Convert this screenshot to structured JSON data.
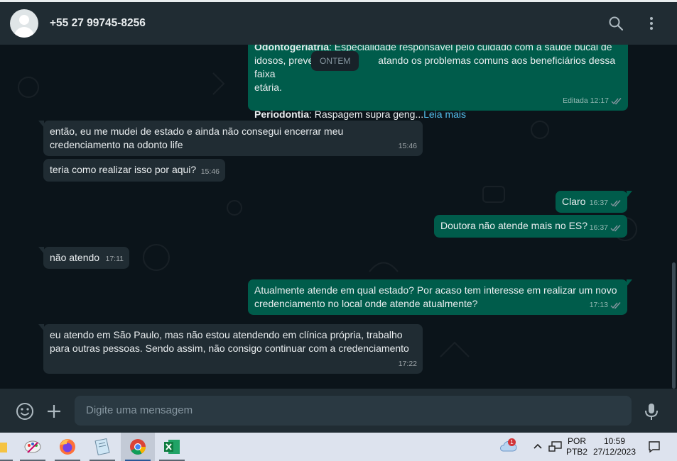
{
  "header": {
    "contact_name": "+55 27 99745-8256",
    "icons": [
      "search-icon",
      "menu-icon"
    ]
  },
  "chat": {
    "date_divider": "ONTEM",
    "messages": [
      {
        "direction": "outgoing",
        "line1_bold": "Odontogeriatria",
        "line1_rest": ": Especialidade responsável pelo cuidado com a saúde bucal de",
        "line2": "idosos, preve",
        "line2_rest": "atando os problemas comuns aos beneficiários dessa faixa",
        "line3": "etária.",
        "line4_bold": "Periodontia",
        "line4_rest": ": Raspagem supra geng...",
        "read_more": "Leia mais",
        "edited": "Editada",
        "time": "12:17",
        "status": "read"
      },
      {
        "direction": "incoming",
        "line1": "então, eu me mudei de estado e ainda não consegui encerrar meu",
        "line2": "credenciamento na odonto life",
        "time": "15:46"
      },
      {
        "direction": "incoming",
        "text": "teria como realizar isso por aqui?",
        "time": "15:46"
      },
      {
        "direction": "outgoing",
        "text": "Claro",
        "time": "16:37",
        "status": "read"
      },
      {
        "direction": "outgoing",
        "text": "Doutora não atende mais no ES?",
        "time": "16:37",
        "status": "read"
      },
      {
        "direction": "incoming",
        "text": "não atendo",
        "time": "17:11"
      },
      {
        "direction": "outgoing",
        "line1": "Atualmente atende em qual estado? Por acaso tem interesse em realizar um novo",
        "line2": "credenciamento no local onde atende atualmente?",
        "time": "17:13",
        "status": "read"
      },
      {
        "direction": "incoming",
        "line1": "eu atendo em São Paulo, mas não estou atendendo em clínica própria, trabalho",
        "line2": "para outras pessoas. Sendo assim, não consigo continuar com a credenciamento",
        "time": "17:22"
      }
    ]
  },
  "composer": {
    "placeholder": "Digite uma mensagem",
    "icons": [
      "emoji-icon",
      "attach-plus-icon",
      "microphone-icon"
    ]
  },
  "taskbar": {
    "apps": [
      "file-explorer-icon",
      "paint-icon",
      "firefox-icon",
      "notepad-icon",
      "chrome-icon",
      "excel-icon"
    ],
    "active_app": "chrome-icon",
    "weather_badge": "1",
    "language": "POR",
    "layout": "PTB2",
    "time": "10:59",
    "date": "27/12/2023"
  },
  "colors": {
    "header_bg": "#202c33",
    "chat_bg": "#0b141a",
    "incoming_bubble": "#202c33",
    "outgoing_bubble": "#005c4b",
    "link": "#53bdeb",
    "text": "#e9edef",
    "muted": "#8696a0"
  }
}
